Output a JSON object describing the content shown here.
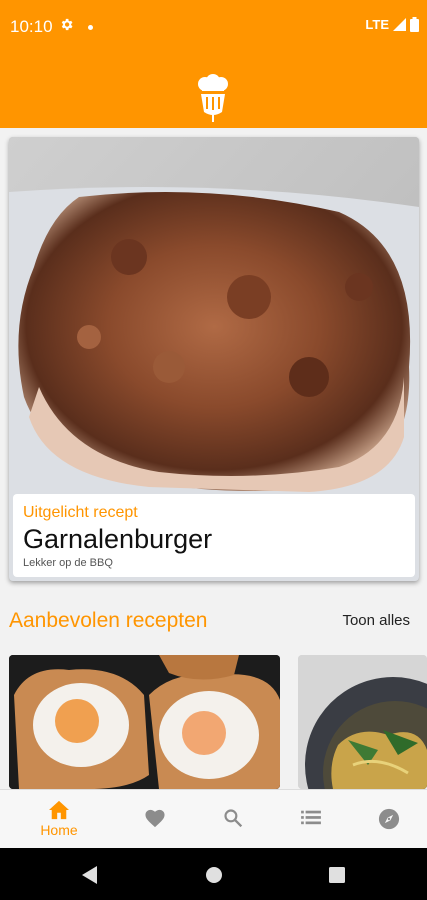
{
  "status_bar": {
    "time": "10:10",
    "network": "LTE"
  },
  "featured": {
    "kicker": "Uitgelicht recept",
    "title": "Garnalenburger",
    "subtitle": "Lekker op de BBQ"
  },
  "recommended": {
    "title": "Aanbevolen recepten",
    "see_all": "Toon alles"
  },
  "bottom_nav": {
    "home_label": "Home",
    "items": [
      "home-icon",
      "heart-icon",
      "search-icon",
      "list-icon",
      "compass-icon"
    ]
  },
  "colors": {
    "accent": "#FF9500"
  }
}
